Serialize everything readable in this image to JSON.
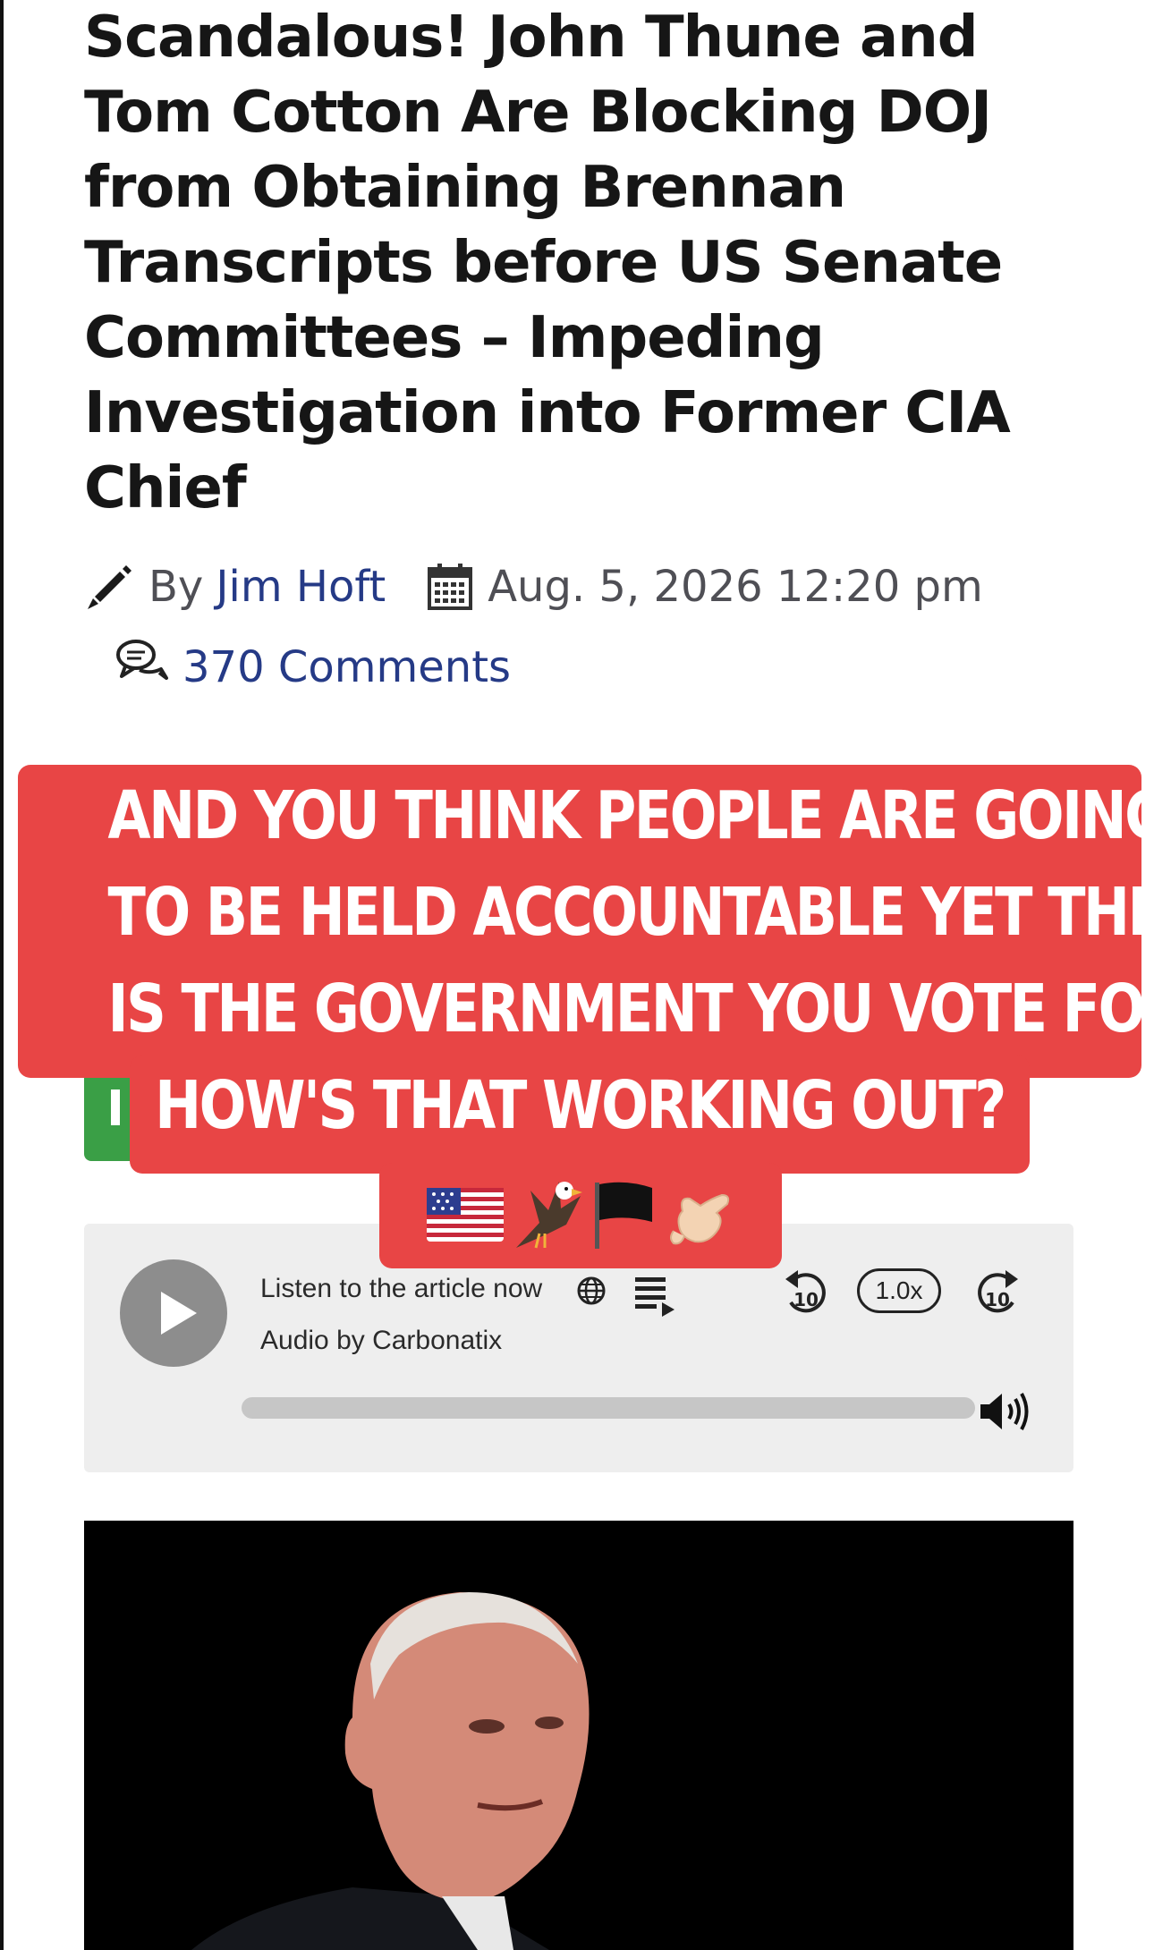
{
  "article": {
    "title_lines": [
      "Scandalous! John Thune and",
      "Tom Cotton Are Blocking DOJ",
      "from Obtaining Brennan",
      "Transcripts before US Senate",
      "Committees – Impeding",
      "Investigation into Former CIA",
      "Chief"
    ],
    "by_label": "By",
    "author": "Jim Hoft",
    "date": "Aug. 5, 2026 12:20 pm",
    "comments": "370 Comments"
  },
  "overlay": {
    "lines": [
      "AND YOU THINK PEOPLE ARE GOING",
      "TO BE HELD ACCOUNTABLE YET THIS",
      "IS THE GOVERNMENT YOU VOTE FOR!",
      "HOW'S THAT WORKING OUT?"
    ],
    "emojis": [
      "us-flag",
      "eagle",
      "black-flag",
      "call-me-hand"
    ],
    "background": "#e84545"
  },
  "audio_player": {
    "listen_label": "Listen to the article now",
    "provider_label": "Audio by Carbonatix",
    "speed": "1.0x",
    "rewind_seconds": "10",
    "forward_seconds": "10",
    "progress": 0
  },
  "icons": {
    "author": "pencil-icon",
    "date": "calendar-icon",
    "comments": "chat-bubbles-icon",
    "play": "play-icon",
    "language": "globe-icon",
    "playlist": "playlist-icon",
    "rewind": "rewind-10-icon",
    "forward": "forward-10-icon",
    "volume": "volume-icon"
  },
  "colors": {
    "link": "#253a86",
    "headline": "#161616",
    "overlay": "#e84545",
    "share_button": "#3a9f46"
  }
}
